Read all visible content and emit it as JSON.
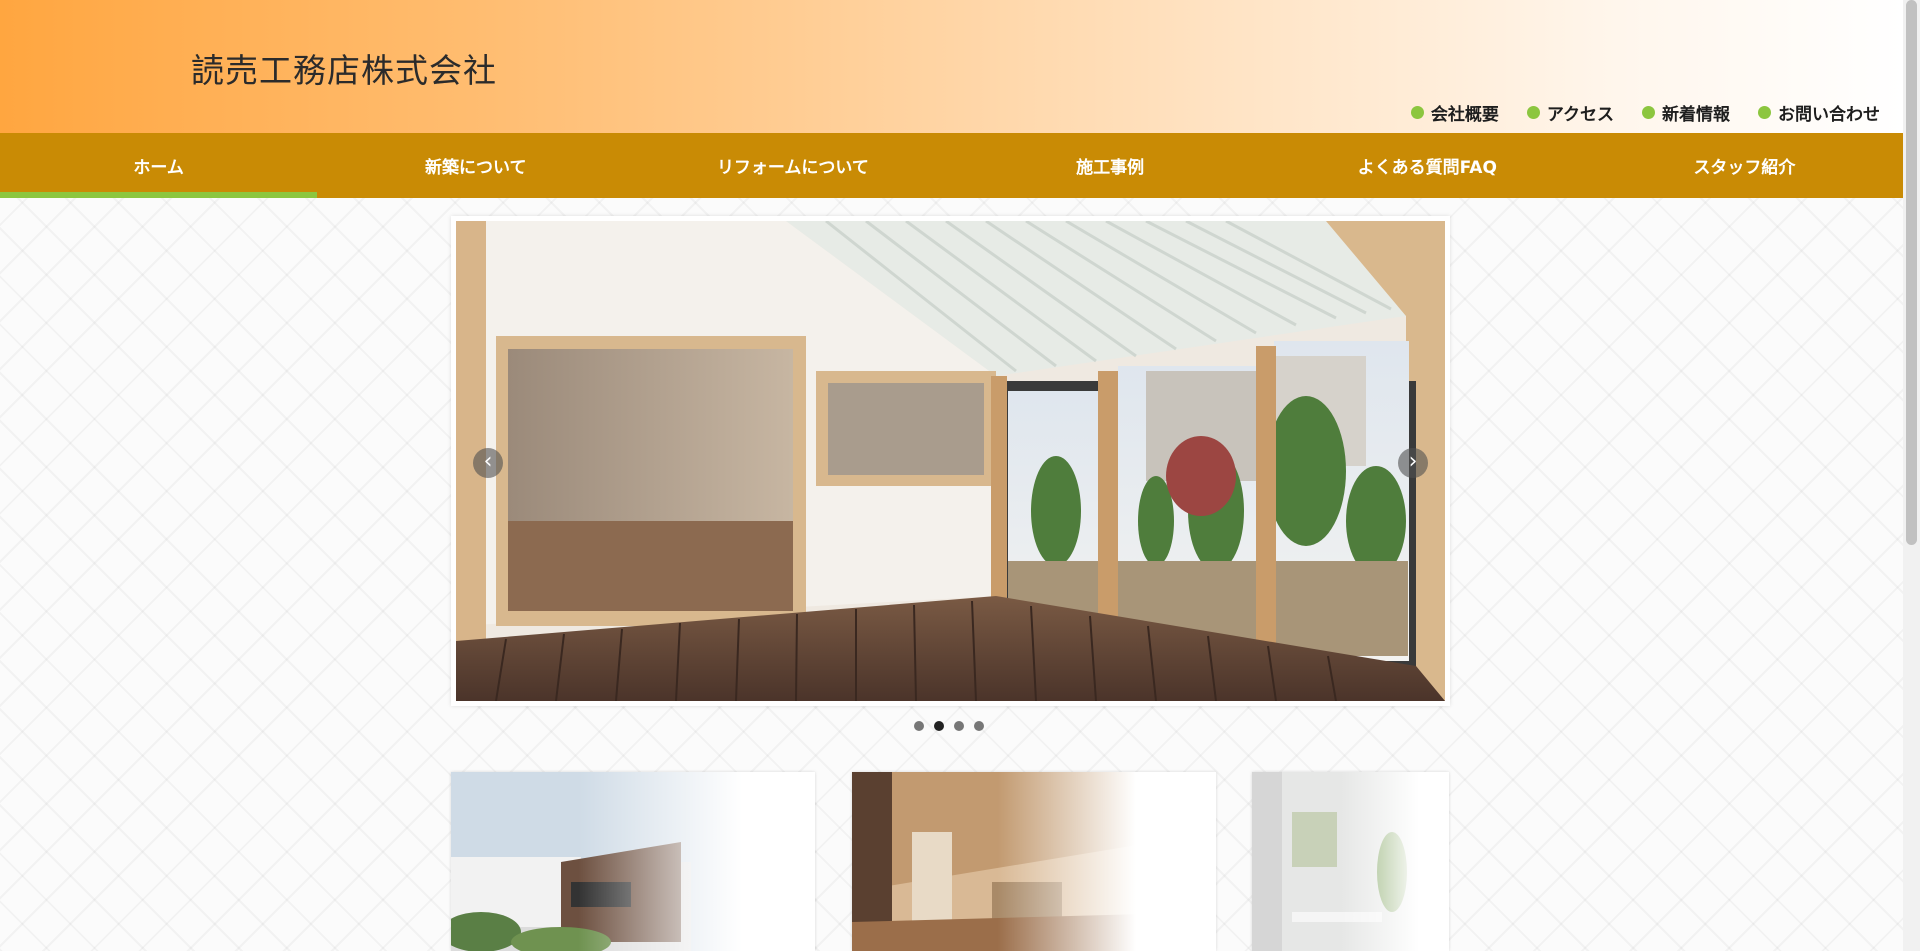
{
  "header": {
    "logo": "読売工務店株式会社",
    "util_nav": [
      "会社概要",
      "アクセス",
      "新着情報",
      "お問い合わせ"
    ]
  },
  "main_nav": {
    "items": [
      "ホーム",
      "新築について",
      "リフォームについて",
      "施工事例",
      "よくある質問FAQ",
      "スタッフ紹介"
    ],
    "active_index": 0
  },
  "slider": {
    "prev_symbol": "‹",
    "next_symbol": "›",
    "slide_count": 4,
    "active_slide": 2
  },
  "colors": {
    "nav_bg": "#c98b05",
    "accent_green": "#8cc63f",
    "header_orange": "#ffa640"
  }
}
